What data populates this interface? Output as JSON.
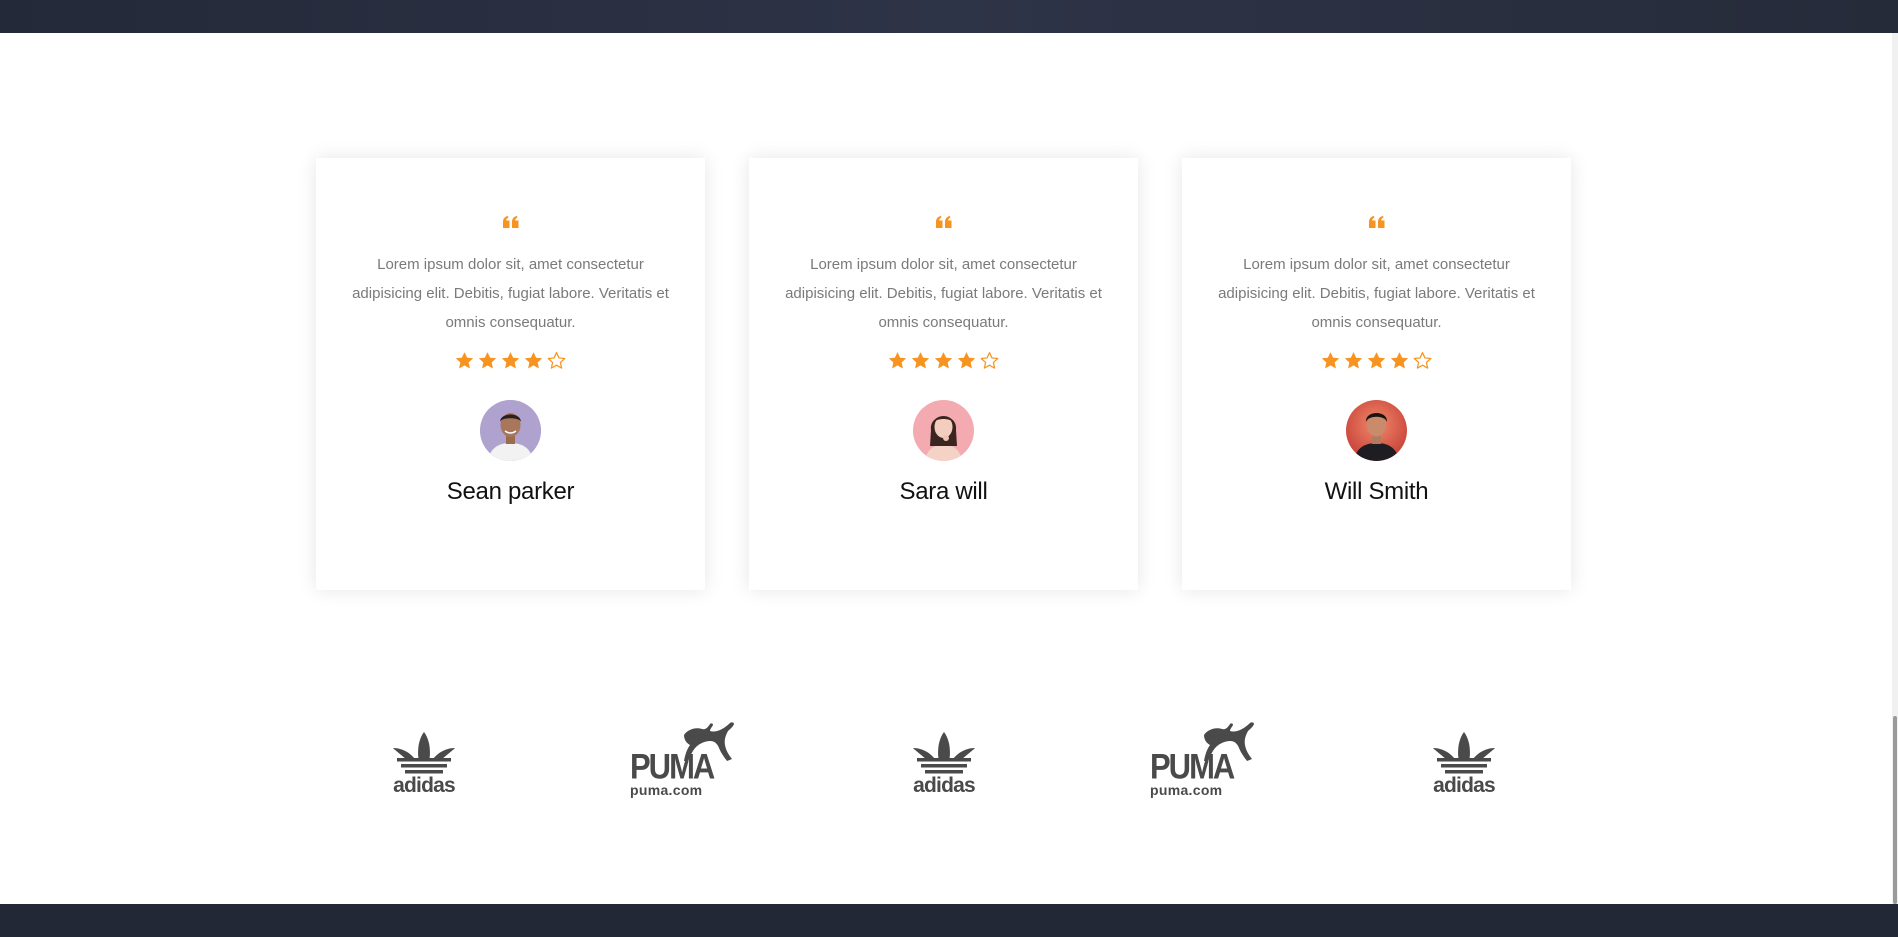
{
  "testimonials": [
    {
      "text": "Lorem ipsum dolor sit, amet consectetur adipisicing elit. Debitis, fugiat labore. Veritatis et omnis consequatur.",
      "rating": 4,
      "rating_max": 5,
      "name": "Sean parker",
      "avatar_bg": "#9c8fbf"
    },
    {
      "text": "Lorem ipsum dolor sit, amet consectetur adipisicing elit. Debitis, fugiat labore. Veritatis et omnis consequatur.",
      "rating": 4,
      "rating_max": 5,
      "name": "Sara will",
      "avatar_bg": "#f0a5a8"
    },
    {
      "text": "Lorem ipsum dolor sit, amet consectetur adipisicing elit. Debitis, fugiat labore. Veritatis et omnis consequatur.",
      "rating": 4,
      "rating_max": 5,
      "name": "Will Smith",
      "avatar_bg": "#e0604f"
    }
  ],
  "brands": [
    {
      "type": "adidas",
      "label": "adidas"
    },
    {
      "type": "puma",
      "word": "PUMA",
      "label": "puma.com"
    },
    {
      "type": "adidas",
      "label": "adidas"
    },
    {
      "type": "puma",
      "word": "PUMA",
      "label": "puma.com"
    },
    {
      "type": "adidas",
      "label": "adidas"
    }
  ],
  "colors": {
    "accent": "#f7931e",
    "header_bg": "#2a3041",
    "footer_bg": "#232836",
    "text_muted": "#7a7a7a",
    "logo_gray": "#4a4a4a"
  }
}
